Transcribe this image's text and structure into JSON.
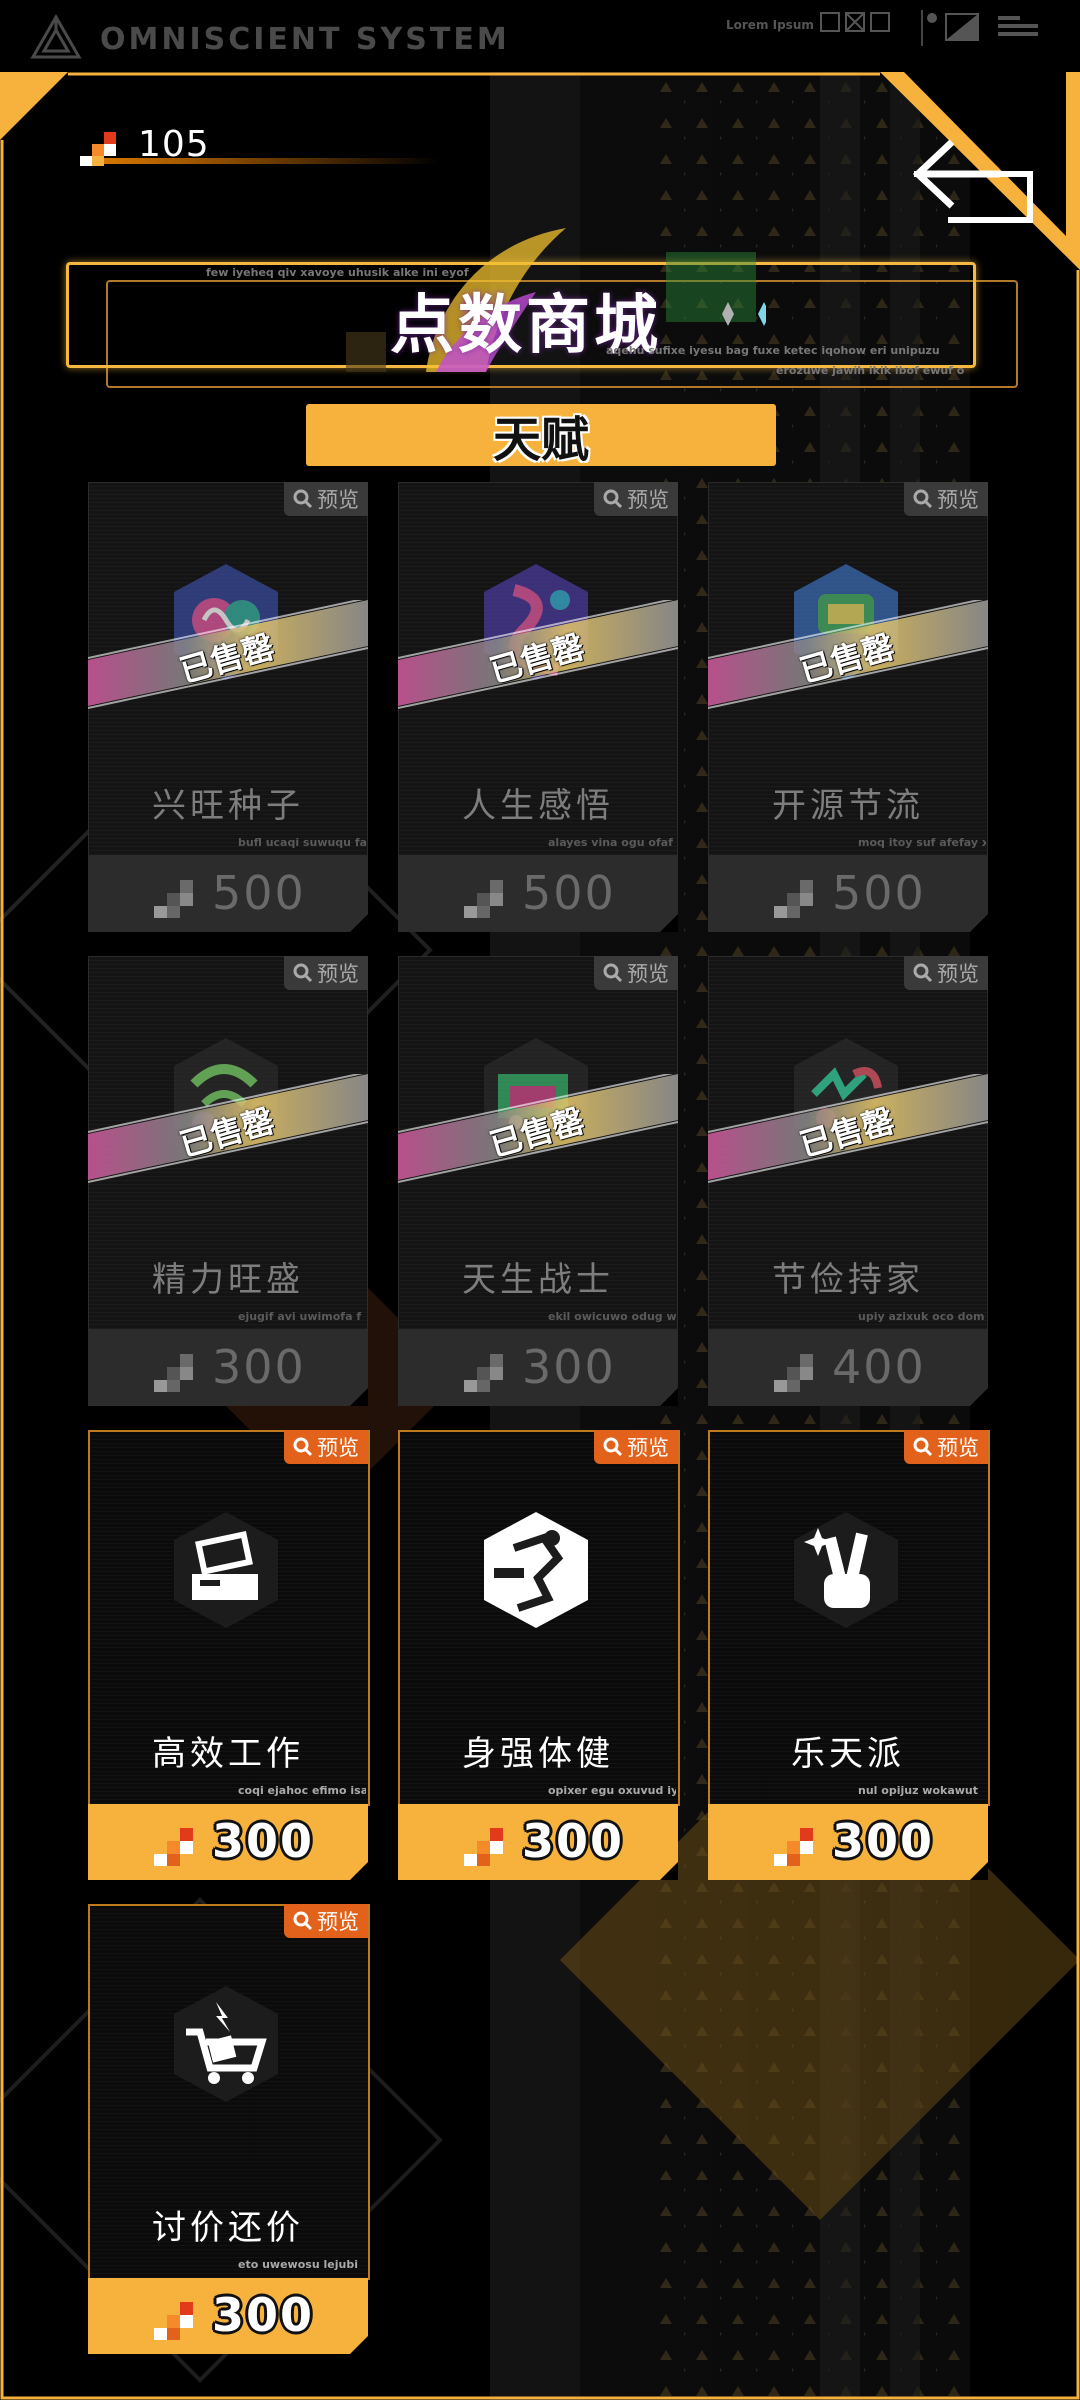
{
  "system": {
    "title": "OMNISCIENT SYSTEM",
    "lorem": "Lorem Ipsum"
  },
  "points": {
    "value": "105"
  },
  "header": {
    "title": "点数商城",
    "micro_top": "few iyeheq qiv xavoye uhusik alke ini eyof",
    "micro_right": "aqehu sufixe iyesu bag fuxe ketec iqohow eri unipuzu",
    "micro_bottom": "erozuwe jawih ikik ibof ewuf o"
  },
  "tab": {
    "label": "天赋"
  },
  "labels": {
    "preview": "预览",
    "sold_out": "已售罄"
  },
  "cards": [
    {
      "name": "兴旺种子",
      "price": "500",
      "status": "sold",
      "micro": "bufl ucaqi suwuqu fa"
    },
    {
      "name": "人生感悟",
      "price": "500",
      "status": "sold",
      "micro": "alayes vina ogu ofaf"
    },
    {
      "name": "开源节流",
      "price": "500",
      "status": "sold",
      "micro": "moq itoy suf afefay x"
    },
    {
      "name": "精力旺盛",
      "price": "300",
      "status": "sold",
      "micro": "ejugif avi uwimofa f"
    },
    {
      "name": "天生战士",
      "price": "300",
      "status": "sold",
      "micro": "ekil owicuwo odug w"
    },
    {
      "name": "节俭持家",
      "price": "400",
      "status": "sold",
      "micro": "upiy azixuk oco dom"
    },
    {
      "name": "高效工作",
      "price": "300",
      "status": "available",
      "micro": "coqi ejahoc efimo isa"
    },
    {
      "name": "身强体健",
      "price": "300",
      "status": "available",
      "micro": "opixer egu oxuvud iy"
    },
    {
      "name": "乐天派",
      "price": "300",
      "status": "available",
      "micro": "nul opijuz wokawut"
    },
    {
      "name": "讨价还价",
      "price": "300",
      "status": "available",
      "micro": "eto uwewosu lejubi"
    }
  ],
  "colors": {
    "accent": "#f6b23c",
    "orange": "#e2621b",
    "frame": "#f6b23c"
  }
}
